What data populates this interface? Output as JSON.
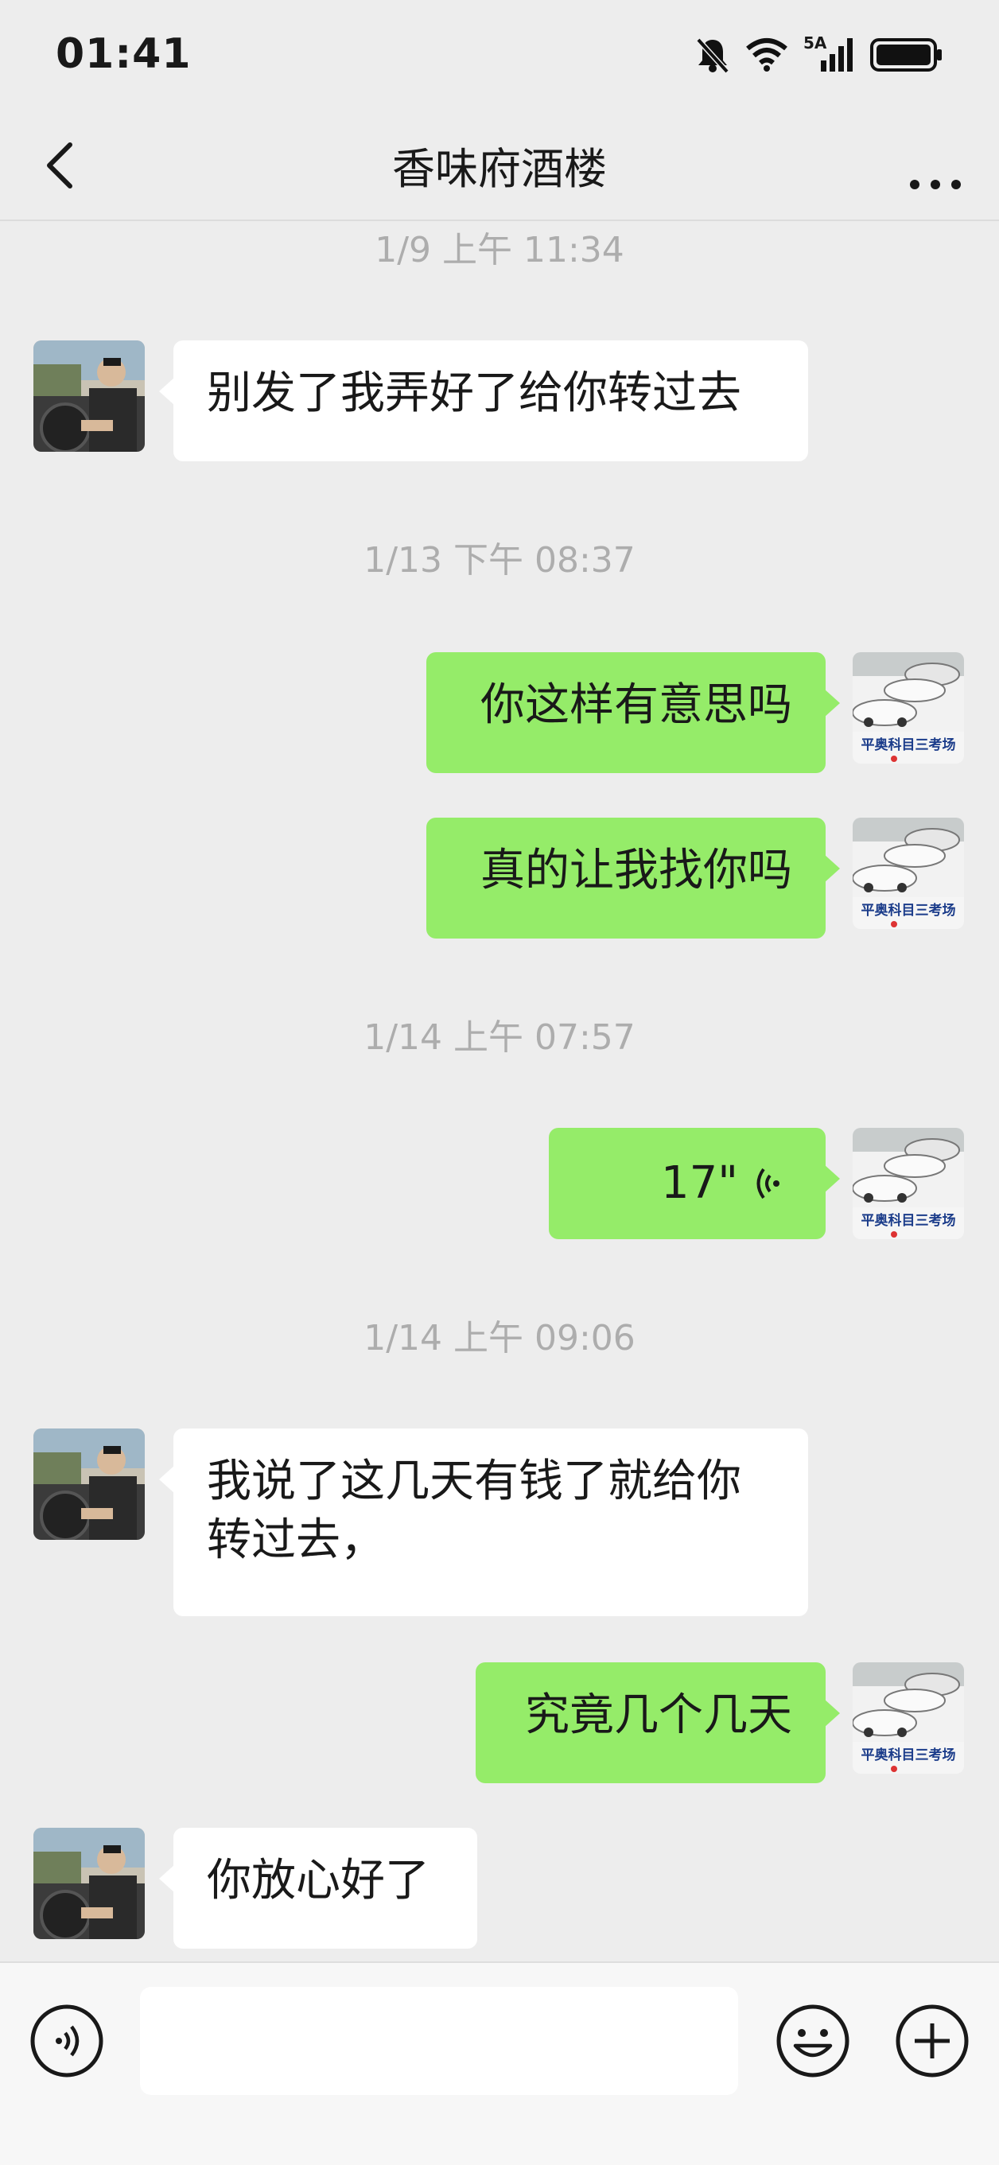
{
  "status": {
    "time": "01:41",
    "network": "5A"
  },
  "header": {
    "title": "香味府酒楼"
  },
  "avatars": {
    "self_caption": "平奥科目三考场"
  },
  "messages": [
    {
      "type": "timestamp",
      "text": "1/9 上午 11:34"
    },
    {
      "type": "text",
      "side": "left",
      "text": "别发了我弄好了给你转过去"
    },
    {
      "type": "timestamp",
      "text": "1/13 下午 08:37"
    },
    {
      "type": "text",
      "side": "right",
      "text": "你这样有意思吗"
    },
    {
      "type": "text",
      "side": "right",
      "text": "真的让我找你吗"
    },
    {
      "type": "timestamp",
      "text": "1/14 上午 07:57"
    },
    {
      "type": "voice",
      "side": "right",
      "duration": "17\""
    },
    {
      "type": "timestamp",
      "text": "1/14 上午 09:06"
    },
    {
      "type": "text",
      "side": "left",
      "text_line1": "我说了这几天有钱了就给你",
      "text_line2": "转过去，"
    },
    {
      "type": "text",
      "side": "right",
      "text": "究竟几个几天"
    },
    {
      "type": "text",
      "side": "left",
      "text": "你放心好了"
    }
  ],
  "colors": {
    "background": "#ededed",
    "sent_bubble": "#95ec69",
    "received_bubble": "#ffffff"
  }
}
